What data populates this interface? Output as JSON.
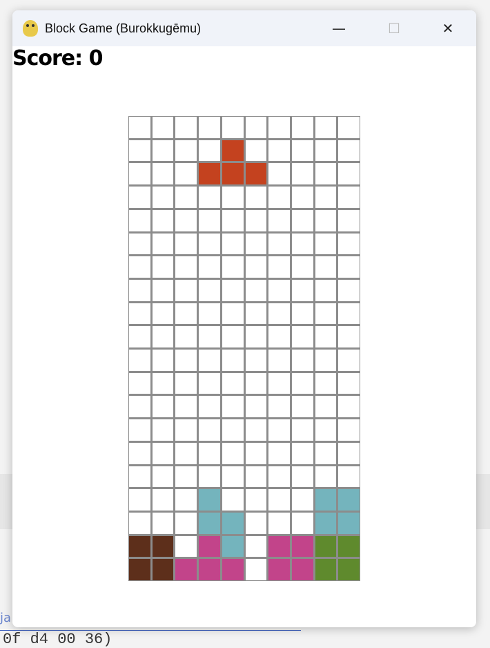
{
  "window": {
    "title": "Block Game (Burokkugēmu)",
    "minimize": "—",
    "maximize": "☐",
    "close": "✕"
  },
  "score_label": "Score: 0",
  "background": {
    "link_text": "ja",
    "code_text": "0f d4 00 36)"
  },
  "colors": {
    "T": "#c4421f",
    "I": "#74b4bd",
    "P": "#c2448a",
    "B": "#5d2f1b",
    "G": "#5f8a2d",
    "empty": "#ffffff"
  },
  "board": [
    "..........",
    "....T.....",
    "...TTT....",
    "..........",
    "..........",
    "..........",
    "..........",
    "..........",
    "..........",
    "..........",
    "..........",
    "..........",
    "..........",
    "..........",
    "..........",
    "..........",
    "...I....II",
    "...II...II",
    "BB.PI.PPGG",
    "BBPPP.PPGG"
  ]
}
